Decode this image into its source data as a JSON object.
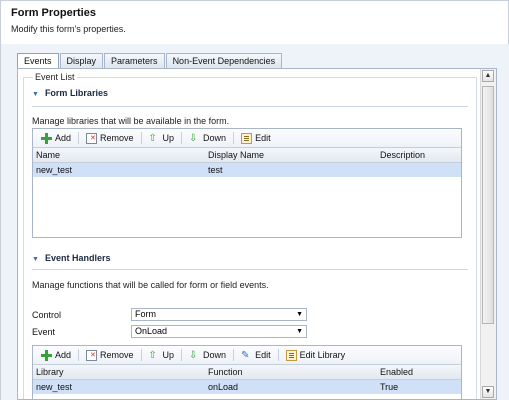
{
  "header": {
    "title": "Form Properties",
    "subtitle": "Modify this form's properties."
  },
  "tabs": [
    {
      "label": "Events",
      "active": true
    },
    {
      "label": "Display",
      "active": false
    },
    {
      "label": "Parameters",
      "active": false
    },
    {
      "label": "Non-Event Dependencies",
      "active": false
    }
  ],
  "event_list": {
    "legend": "Event List",
    "form_libraries": {
      "heading": "Form Libraries",
      "description": "Manage libraries that will be available in the form.",
      "toolbar": {
        "add": "Add",
        "remove": "Remove",
        "up": "Up",
        "down": "Down",
        "edit": "Edit"
      },
      "columns": [
        "Name",
        "Display Name",
        "Description"
      ],
      "rows": [
        {
          "name": "new_test",
          "display_name": "test",
          "description": "",
          "selected": true
        }
      ]
    },
    "event_handlers": {
      "heading": "Event Handlers",
      "description": "Manage functions that will be called for form or field events.",
      "control_label": "Control",
      "control_value": "Form",
      "event_label": "Event",
      "event_value": "OnLoad",
      "toolbar": {
        "add": "Add",
        "remove": "Remove",
        "up": "Up",
        "down": "Down",
        "edit": "Edit",
        "edit_library": "Edit Library"
      },
      "columns": [
        "Library",
        "Function",
        "Enabled"
      ],
      "rows": [
        {
          "library": "new_test",
          "function": "onLoad",
          "enabled": "True",
          "selected": true
        }
      ]
    }
  },
  "icons": {
    "add": "plus-icon",
    "remove": "remove-icon",
    "up": "arrow-up-icon",
    "down": "arrow-down-icon",
    "edit": "edit-icon",
    "section": "chevron-down-icon",
    "dropdown": "dropdown-arrow-icon"
  },
  "colors": {
    "selected_row": "#cfe0f7",
    "section_arrow": "#3c6db3",
    "add_green": "#37a13b",
    "remove_red": "#d0312d"
  }
}
